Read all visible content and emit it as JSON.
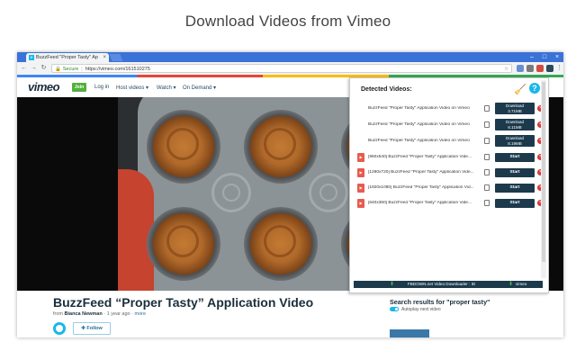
{
  "headline": "Download Videos from Vimeo",
  "browser": {
    "tab_title": "BuzzFeed \"Proper Tasty\" Ap",
    "secure_label": "Secure",
    "url": "https://vimeo.com/161510275"
  },
  "vimeo": {
    "logo": "vimeo",
    "join": "Join",
    "nav": [
      "Log in",
      "Host videos ▾",
      "Watch ▾",
      "On Demand ▾"
    ]
  },
  "panel": {
    "title": "Detected Videos:",
    "rows": [
      {
        "title": "BuzzFeed \"Proper Tasty\" Application Video on Vimeo",
        "button_line1": "Download",
        "button_line2": "3.71MB",
        "type": "download"
      },
      {
        "title": "BuzzFeed \"Proper Tasty\" Application Video on Vimeo",
        "button_line1": "Download",
        "button_line2": "6.11MB",
        "type": "download"
      },
      {
        "title": "BuzzFeed \"Proper Tasty\" Application Video on Vimeo",
        "button_line1": "Download",
        "button_line2": "8.19MB",
        "type": "download"
      },
      {
        "title": "[960x540] BuzzFeed \"Proper Tasty\" Application Vide...",
        "button_line1": "Start",
        "type": "start"
      },
      {
        "title": "[1280x720] BuzzFeed \"Proper Tasty\" Application Vide...",
        "button_line1": "Start",
        "type": "start"
      },
      {
        "title": "[1920x1080] BuzzFeed \"Proper Tasty\" Application Vid...",
        "button_line1": "Start",
        "type": "start"
      },
      {
        "title": "[640x360] BuzzFeed \"Proper Tasty\" Application Vide...",
        "button_line1": "Start",
        "type": "start"
      }
    ],
    "footer_text": "FBDOWN.net Video Downloader : ID",
    "footer_right": "vimeo"
  },
  "video": {
    "title": "BuzzFeed “Proper Tasty” Application Video",
    "from": "from",
    "author": "Bianca Newman",
    "ago": "1 year ago",
    "more": "more",
    "follow": "✚ Follow"
  },
  "sidebar": {
    "search_results": "Search results for \"proper tasty\"",
    "autoplay": "Autoplay next video"
  },
  "colors": {
    "vimeo_blue": "#1ab7ea",
    "join_green": "#53b03d",
    "panel_button": "#1d3a4c"
  }
}
